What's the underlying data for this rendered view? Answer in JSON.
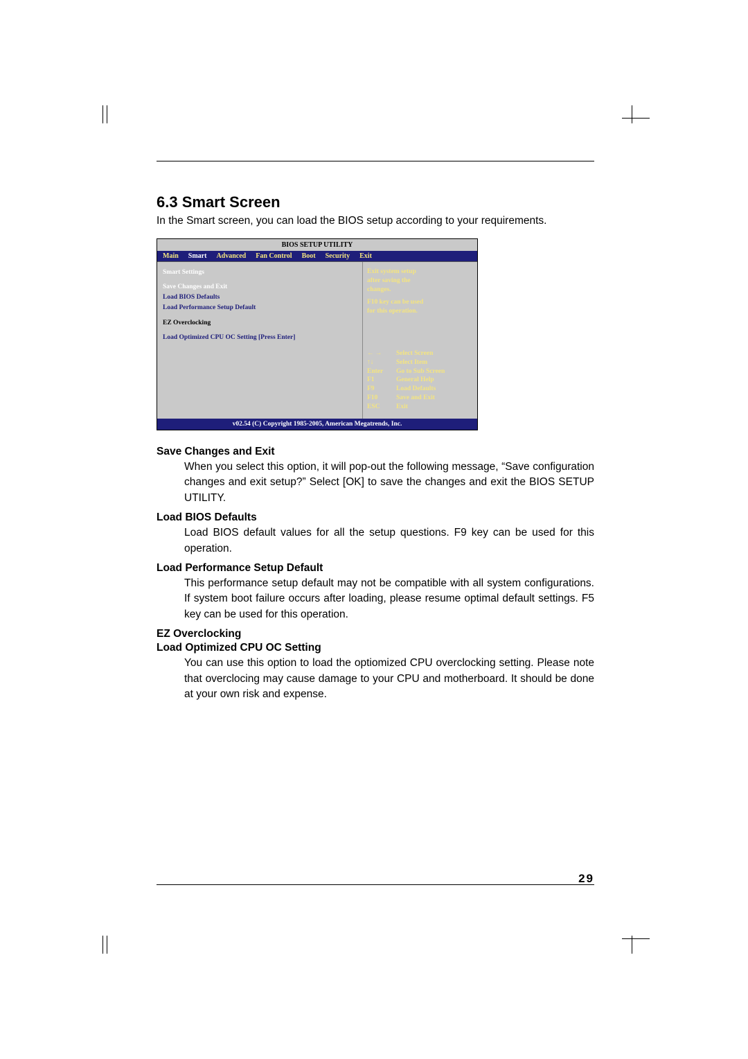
{
  "heading": "6.3  Smart Screen",
  "intro": "In the Smart screen, you can load the BIOS setup according to your requirements.",
  "bios": {
    "title": "BIOS  SETUP  UTILITY",
    "tabs": [
      "Main",
      "Smart",
      "Advanced",
      "Fan Control",
      "Boot",
      "Security",
      "Exit"
    ],
    "active_tab_index": 1,
    "left": {
      "heading": "Smart  Settings",
      "items": [
        "Save Changes and Exit",
        "Load BIOS Defaults",
        "Load Performance Setup Default"
      ],
      "sub_heading": "EZ  Overclocking",
      "sub_item": "Load Optimized CPU OC Setting [Press Enter]"
    },
    "right": {
      "desc1": "Exit system setup",
      "desc2": "after saving the",
      "desc3": "changes.",
      "desc4": "F10 key can be used",
      "desc5": "for this operation.",
      "help": [
        {
          "key": "← →",
          "label": "Select Screen"
        },
        {
          "key": "↑↓",
          "label": "Select Item"
        },
        {
          "key": "Enter",
          "label": "Go to Sub Screen"
        },
        {
          "key": "F1",
          "label": "General Help"
        },
        {
          "key": "F9",
          "label": "Load Defaults"
        },
        {
          "key": "F10",
          "label": "Save and Exit"
        },
        {
          "key": "ESC",
          "label": "Exit"
        }
      ]
    },
    "footer": "v02.54 (C) Copyright 1985-2005, American Megatrends, Inc."
  },
  "terms": [
    {
      "title": "Save Changes and Exit",
      "body": "When you select this option, it will pop-out the following message, “Save configuration changes and exit setup?” Select [OK] to save the changes and exit the BIOS SETUP UTILITY."
    },
    {
      "title": "Load BIOS Defaults",
      "body": "Load BIOS default values for all the setup questions. F9 key can be used for this operation."
    },
    {
      "title": "Load Performance Setup Default",
      "body": "This performance setup default may not be compatible with all system configurations. If system boot failure occurs after loading, please resume optimal default settings. F5 key can be used for this operation."
    },
    {
      "title": "EZ Overclocking",
      "body": ""
    },
    {
      "title": "Load Optimized CPU OC Setting",
      "body": "You can use this option to load the optiomized CPU overclocking setting. Please note that overclocing may cause damage to your CPU and motherboard. It should be done at your own risk and expense."
    }
  ],
  "page_number": "29"
}
